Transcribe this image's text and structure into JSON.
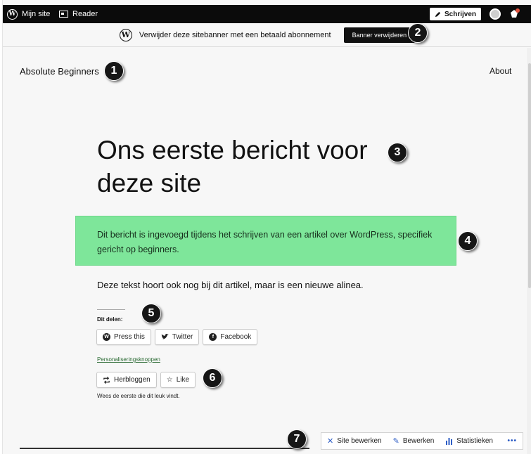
{
  "admin_bar": {
    "my_site": "Mijn site",
    "reader": "Reader",
    "write": "Schrijven"
  },
  "banner": {
    "text": "Verwijder deze sitebanner met een betaald abonnement",
    "button": "Banner verwijderen"
  },
  "header": {
    "site_title": "Absolute Beginners",
    "nav_about": "About"
  },
  "post": {
    "title_line1": "Ons eerste bericht voor",
    "title_line2": "deze site",
    "highlight_text": "Dit bericht is ingevoegd tijdens het schrijven van een artikel over WordPress, specifiek gericht op beginners.",
    "paragraph": "Deze tekst hoort ook nog bij dit artikel, maar is een nieuwe alinea."
  },
  "sharing": {
    "label": "Dit delen:",
    "buttons": [
      "Press this",
      "Twitter",
      "Facebook"
    ],
    "personalise_link": "Personaliseringsknoppen"
  },
  "likes": {
    "reblog": "Herbloggen",
    "like": "Like",
    "note": "Wees de eerste die dit leuk vindt."
  },
  "edit_bar": {
    "site_edit": "Site bewerken",
    "edit": "Bewerken",
    "stats": "Statistieken",
    "more": "•••"
  },
  "markers": [
    "1",
    "2",
    "3",
    "4",
    "5",
    "6",
    "7"
  ],
  "colors": {
    "admin_bar": "#0b0b0b",
    "highlight_bg": "#7ee69a",
    "link_green": "#2b6b34",
    "accent_blue": "#2c5cc5"
  }
}
